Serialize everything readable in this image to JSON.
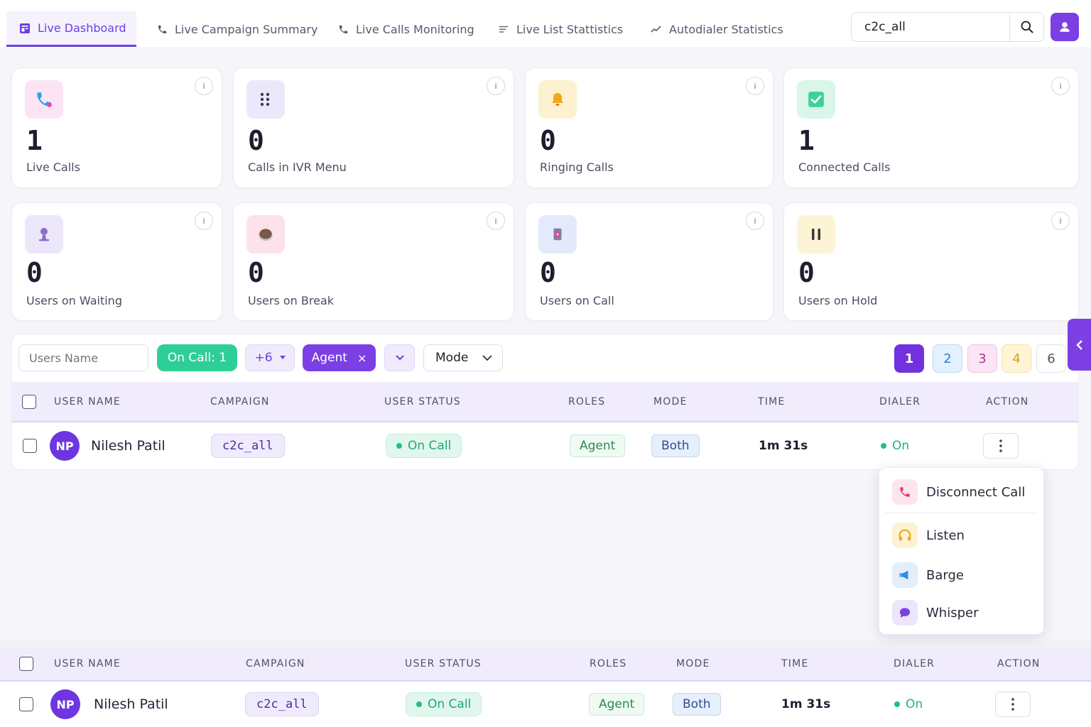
{
  "nav": {
    "tabs": [
      {
        "label": "Live Dashboard",
        "icon": "dashboard-icon"
      },
      {
        "label": "Live Campaign Summary",
        "icon": "phone-icon"
      },
      {
        "label": "Live Calls Monitoring",
        "icon": "phone-icon"
      },
      {
        "label": "Live List Stattistics",
        "icon": "list-icon"
      },
      {
        "label": "Autodialer Statistics",
        "icon": "trend-icon"
      }
    ],
    "search_value": "c2c_all"
  },
  "stats": [
    {
      "value": "1",
      "label": "Live Calls",
      "icon": "phone-icon"
    },
    {
      "value": "0",
      "label": "Calls in IVR Menu",
      "icon": "grid-dots-icon"
    },
    {
      "value": "0",
      "label": "Ringing Calls",
      "icon": "bell-icon"
    },
    {
      "value": "1",
      "label": "Connected Calls",
      "icon": "check-icon"
    },
    {
      "value": "0",
      "label": "Users on Waiting",
      "icon": "user-icon"
    },
    {
      "value": "0",
      "label": "Users on Break",
      "icon": "cup-icon"
    },
    {
      "value": "0",
      "label": "Users on Call",
      "icon": "headset-icon"
    },
    {
      "value": "0",
      "label": "Users on Hold",
      "icon": "pause-icon"
    }
  ],
  "info_label": "i",
  "filters": {
    "users_placeholder": "Users Name",
    "oncall_label": "On Call: 1",
    "more_label": "+6",
    "agent_label": "Agent",
    "agent_remove": "×",
    "mode_label": "Mode"
  },
  "pagination": [
    "1",
    "2",
    "3",
    "4",
    "6"
  ],
  "table": {
    "headers": [
      "USER NAME",
      "CAMPAIGN",
      "USER STATUS",
      "ROLES",
      "MODE",
      "TIME",
      "DIALER",
      "ACTION"
    ],
    "row": {
      "initials": "NP",
      "name": "Nilesh Patil",
      "campaign": "c2c_all",
      "status": "On Call",
      "role": "Agent",
      "mode": "Both",
      "time": "1m 31s",
      "dialer": "On"
    }
  },
  "action_menu": [
    {
      "label": "Disconnect Call",
      "icon": "phone-hangup-icon"
    },
    {
      "label": "Listen",
      "icon": "headphones-icon"
    },
    {
      "label": "Barge",
      "icon": "megaphone-icon"
    },
    {
      "label": "Whisper",
      "icon": "chat-bubble-icon"
    }
  ],
  "colors": {
    "accent": "#7b3fe4",
    "success": "#2ecf97"
  }
}
